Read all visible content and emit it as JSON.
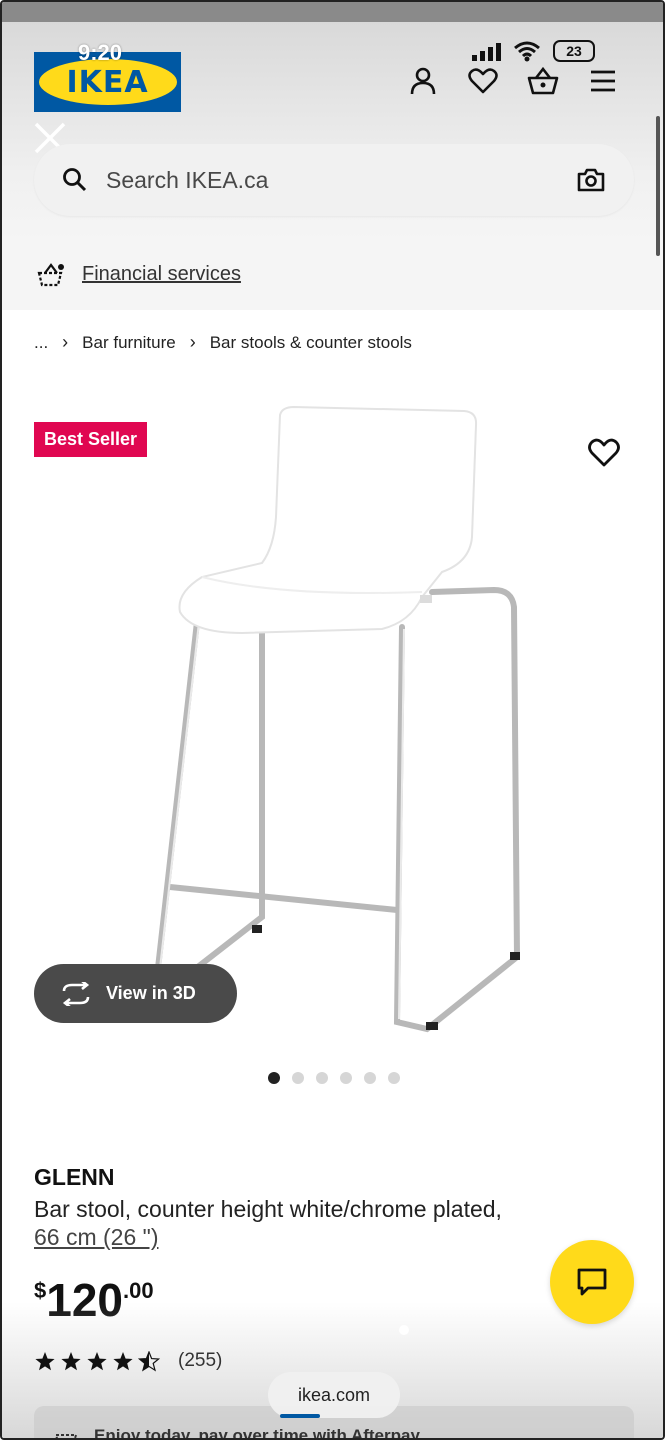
{
  "status": {
    "time": "9:20",
    "battery": "23"
  },
  "header": {
    "logo_text": "IKEA",
    "icons": [
      "profile-icon",
      "heart-icon",
      "basket-icon",
      "menu-icon"
    ]
  },
  "search": {
    "placeholder": "Search IKEA.ca"
  },
  "financial": {
    "label": "Financial services"
  },
  "breadcrumb": {
    "ellipsis": "...",
    "items": [
      "Bar furniture",
      "Bar stools & counter stools"
    ]
  },
  "product": {
    "badge": "Best Seller",
    "view3d_label": "View in 3D",
    "image_count": 6,
    "active_image": 1,
    "name": "GLENN",
    "description": "Bar stool, counter height white/chrome plated,",
    "size": "66 cm (26 \")",
    "price": {
      "currency": "$",
      "integer": "120",
      "decimals": ".00"
    },
    "rating": {
      "value": 4.5,
      "max": 5,
      "count": "(255)"
    }
  },
  "browser": {
    "url": "ikea.com"
  },
  "afterpay": {
    "text": "Enjoy today, pay over time with Afterpay"
  },
  "colors": {
    "ikea_blue": "#0058a3",
    "ikea_yellow": "#ffda1a",
    "badge_red": "#e00751"
  }
}
